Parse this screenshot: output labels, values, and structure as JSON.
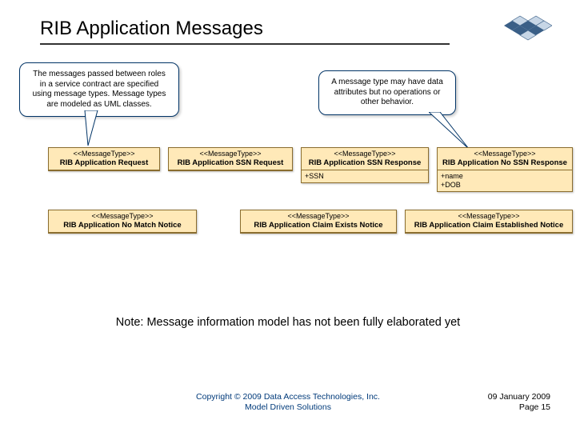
{
  "title_bold": "RIB Application",
  "title_light": " Messages",
  "callout1": "The messages passed between roles in a service contract are specified using message types. Message types are modeled as UML classes.",
  "callout2": "A message type may have data attributes but no operations or other behavior.",
  "stereo": "<<MessageType>>",
  "uml": {
    "row1": [
      {
        "name": "RIB Application Request",
        "attrs": []
      },
      {
        "name": "RIB Application SSN Request",
        "attrs": []
      },
      {
        "name": "RIB Application SSN Response",
        "attrs": [
          "+SSN"
        ]
      },
      {
        "name": "RIB Application No SSN Response",
        "attrs": [
          "+name",
          "+DOB"
        ]
      }
    ],
    "row2": [
      {
        "name": "RIB Application No Match Notice",
        "attrs": []
      },
      {
        "name": "RIB Application Claim Exists Notice",
        "attrs": []
      },
      {
        "name": "RIB Application Claim Established Notice",
        "attrs": []
      }
    ]
  },
  "note": "Note: Message information model has not been fully elaborated yet",
  "footer": {
    "copyright_line1": "Copyright © 2009 Data Access Technologies, Inc.",
    "copyright_line2": "Model Driven Solutions",
    "date": "09 January 2009",
    "page": "Page 15"
  }
}
